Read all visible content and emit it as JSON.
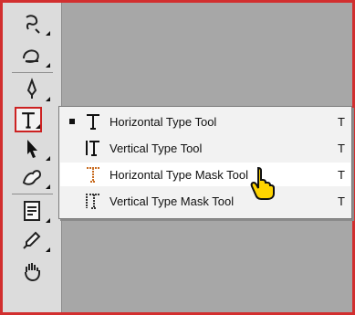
{
  "toolbar": {
    "tools": [
      {
        "name": "healing-brush-icon"
      },
      {
        "name": "eraser-icon"
      },
      {
        "name": "pen-icon"
      },
      {
        "name": "type-tool-icon",
        "selected": true
      },
      {
        "name": "path-selection-icon"
      },
      {
        "name": "custom-shape-icon"
      },
      {
        "name": "notes-icon"
      },
      {
        "name": "eyedropper-icon"
      },
      {
        "name": "hand-icon"
      }
    ]
  },
  "flyout": {
    "items": [
      {
        "label": "Horizontal Type Tool",
        "shortcut": "T",
        "icon": "horizontal-type-icon",
        "active": true
      },
      {
        "label": "Vertical Type Tool",
        "shortcut": "T",
        "icon": "vertical-type-icon",
        "active": false
      },
      {
        "label": "Horizontal Type Mask Tool",
        "shortcut": "T",
        "icon": "horizontal-type-mask-icon",
        "active": false,
        "hovered": true
      },
      {
        "label": "Vertical Type Mask Tool",
        "shortcut": "T",
        "icon": "vertical-type-mask-icon",
        "active": false
      }
    ]
  },
  "colors": {
    "frame": "#d22f2f",
    "canvas": "#a7a7a7",
    "toolbar": "#dcdcdc",
    "flyout": "#f2f2f2",
    "cursor": "#ffd400"
  }
}
